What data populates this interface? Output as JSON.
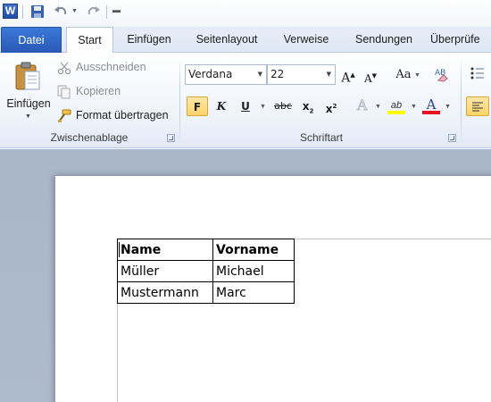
{
  "qat": {
    "app_logo": "W",
    "icons": [
      "word-logo-icon",
      "save-icon",
      "undo-icon",
      "redo-icon",
      "customize-icon"
    ]
  },
  "tabs": [
    {
      "label": "Datei"
    },
    {
      "label": "Start"
    },
    {
      "label": "Einfügen"
    },
    {
      "label": "Seitenlayout"
    },
    {
      "label": "Verweise"
    },
    {
      "label": "Sendungen"
    },
    {
      "label": "Überprüfe"
    }
  ],
  "clipboard": {
    "paste_label": "Einfügen",
    "cut_label": "Ausschneiden",
    "copy_label": "Kopieren",
    "format_painter_label": "Format übertragen",
    "group_label": "Zwischenablage"
  },
  "font": {
    "font_name": "Verdana",
    "font_size": "22",
    "group_label": "Schriftart",
    "bold": "F",
    "italic": "K",
    "underline": "U",
    "strike": "abc",
    "subscript": "x",
    "subscript_mark": "2",
    "superscript": "x",
    "superscript_mark": "2",
    "grow": "A",
    "shrink": "A",
    "case": "Aa",
    "highlight": "ab",
    "font_color": "A"
  },
  "colors": {
    "file_tab": "#2b5cb8",
    "highlight": "#ffff00",
    "font_color": "#e81123",
    "active_button": "#fcd36a"
  },
  "table": {
    "rows": [
      [
        "Name",
        "Vorname"
      ],
      [
        "Müller",
        "Michael"
      ],
      [
        "Mustermann",
        "Marc"
      ]
    ]
  }
}
